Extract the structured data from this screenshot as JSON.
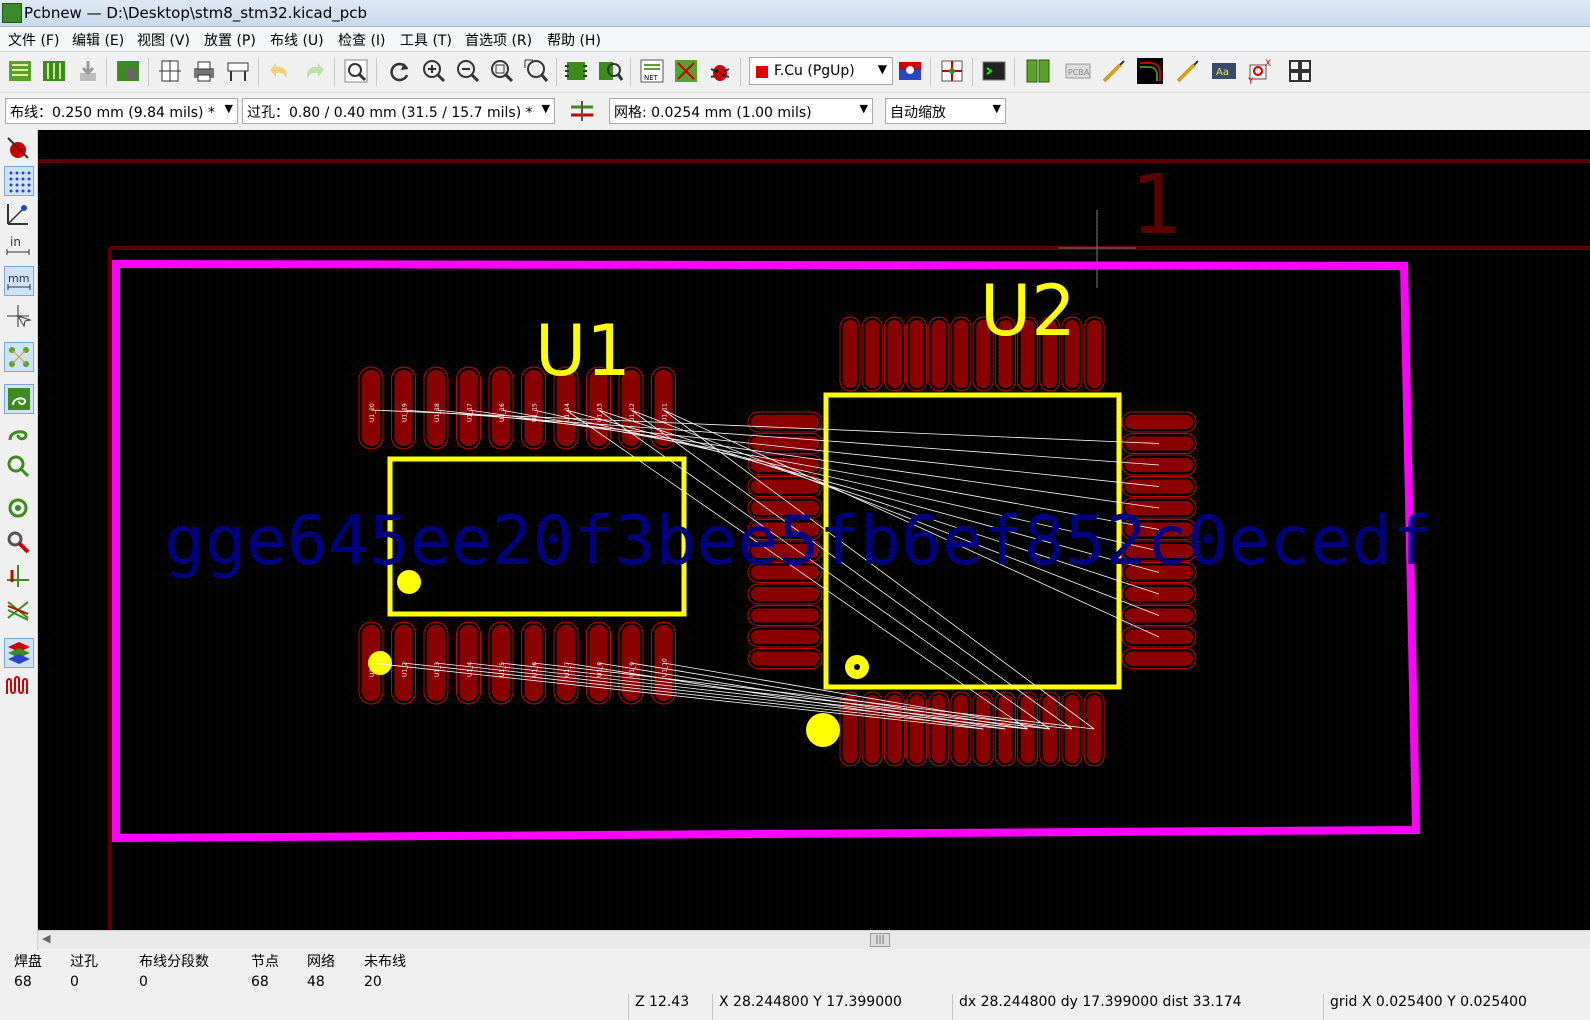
{
  "window": {
    "title": "Pcbnew — D:\\Desktop\\stm8_stm32.kicad_pcb"
  },
  "menu": [
    "文件 (F)",
    "编辑 (E)",
    "视图 (V)",
    "放置 (P)",
    "布线 (U)",
    "检查 (I)",
    "工具 (T)",
    "首选项 (R)",
    "帮助 (H)"
  ],
  "toolbar": {
    "layer_select": "F.Cu (PgUp)",
    "track_width": "布线：0.250 mm (9.84 mils) *",
    "via_size": "过孔：0.80 / 0.40 mm (31.5 / 15.7 mils) *",
    "grid": "网格: 0.0254 mm (1.00 mils)",
    "zoom": "自动缩放"
  },
  "canvas": {
    "sheet_marker": "1",
    "u1_ref": "U1",
    "u2_ref": "U2",
    "watermark": "gge645ee20f3bee5fb6ef852c0ecedf",
    "u1_pad_labels_top": [
      "U1_20",
      "U1_19",
      "U1_18",
      "U1_17",
      "U1_16",
      "U1_15",
      "U1_14",
      "U1_13",
      "U1_12",
      "U1_11"
    ],
    "u1_pad_labels_bottom": [
      "U1_1",
      "U1_2",
      "U1_3",
      "U1_4",
      "U1_5",
      "U1_6",
      "U1_7",
      "U1_8",
      "U1_9",
      "U1_10"
    ],
    "colors": {
      "background": "#000000",
      "board_outline": "#ff00ff",
      "silkscreen": "#ffff00",
      "pads": "#8b0000",
      "pad_outline": "#c80000",
      "watermark": "#000080",
      "ratsnest": "#ffffff",
      "sheet_border": "#5a0000"
    }
  },
  "status": {
    "items": [
      {
        "label": "焊盘",
        "value": "68"
      },
      {
        "label": "过孔",
        "value": "0"
      },
      {
        "label": "布线分段数",
        "value": "0"
      },
      {
        "label": "节点",
        "value": "68"
      },
      {
        "label": "网络",
        "value": "48"
      },
      {
        "label": "未布线",
        "value": "20"
      }
    ],
    "zoom": "Z 12.43",
    "xy": "X 28.244800  Y 17.399000",
    "delta": "dx 28.244800  dy 17.399000  dist 33.174",
    "grid": "grid X 0.025400  Y 0.025400"
  }
}
